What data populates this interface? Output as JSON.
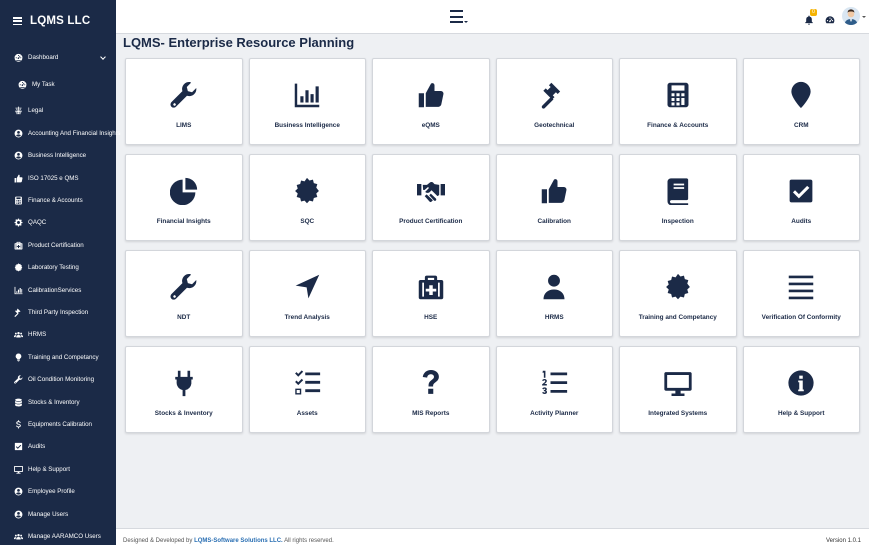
{
  "app": {
    "title": "LQMS LLC"
  },
  "sidebar": {
    "items": [
      {
        "label": "Dashboard",
        "icon": "dashboard-icon"
      },
      {
        "label": "My Task",
        "icon": "dashboard-icon"
      },
      {
        "label": "Legal",
        "icon": "balance-scale-icon"
      },
      {
        "label": "Accounting And Financial Insights",
        "icon": "user-circle-icon"
      },
      {
        "label": "Business Intelligence",
        "icon": "user-circle-icon"
      },
      {
        "label": "ISO 17025 e QMS",
        "icon": "thumbs-up-icon"
      },
      {
        "label": "Finance & Accounts",
        "icon": "calculator-icon"
      },
      {
        "label": "QAQC",
        "icon": "gear-icon"
      },
      {
        "label": "Product Certification",
        "icon": "medkit-icon"
      },
      {
        "label": "Laboratory Testing",
        "icon": "certificate-icon"
      },
      {
        "label": "CalibrationServices",
        "icon": "chart-icon"
      },
      {
        "label": "Third Party Inspection",
        "icon": "gavel-icon"
      },
      {
        "label": "HRMS",
        "icon": "users-icon"
      },
      {
        "label": "Training and Competancy",
        "icon": "lightbulb-icon"
      },
      {
        "label": "Oil Condition Monitoring",
        "icon": "wrench-icon"
      },
      {
        "label": "Stocks & Inventory",
        "icon": "database-icon"
      },
      {
        "label": "Equipments Calibration",
        "icon": "dollar-icon"
      },
      {
        "label": "Audits",
        "icon": "check-square-icon"
      },
      {
        "label": "Help & Support",
        "icon": "desktop-icon"
      },
      {
        "label": "Employee Profile",
        "icon": "user-circle-icon"
      },
      {
        "label": "Manage Users",
        "icon": "user-circle-icon"
      },
      {
        "label": "Manage AARAMCO Users",
        "icon": "users-icon"
      }
    ]
  },
  "topbar": {
    "notification_count": "0"
  },
  "main": {
    "title": "LQMS- Enterprise Resource Planning",
    "tiles": [
      {
        "label": "LIMS",
        "icon": "wrench-icon"
      },
      {
        "label": "Business Intelligence",
        "icon": "bar-chart-icon"
      },
      {
        "label": "eQMS",
        "icon": "thumbs-up-icon"
      },
      {
        "label": "Geotechnical",
        "icon": "gavel-icon"
      },
      {
        "label": "Finance & Accounts",
        "icon": "calculator-icon"
      },
      {
        "label": "CRM",
        "icon": "map-marker-icon"
      },
      {
        "label": "Financial Insights",
        "icon": "pie-chart-icon"
      },
      {
        "label": "SQC",
        "icon": "certificate-icon"
      },
      {
        "label": "Product Certification",
        "icon": "handshake-icon"
      },
      {
        "label": "Calibration",
        "icon": "thumbs-up-icon"
      },
      {
        "label": "Inspection",
        "icon": "book-icon"
      },
      {
        "label": "Audits",
        "icon": "check-square-icon"
      },
      {
        "label": "NDT",
        "icon": "wrench-icon"
      },
      {
        "label": "Trend Analysis",
        "icon": "location-arrow-icon"
      },
      {
        "label": "HSE",
        "icon": "medkit-icon"
      },
      {
        "label": "HRMS",
        "icon": "user-icon"
      },
      {
        "label": "Training and Competancy",
        "icon": "certificate-icon"
      },
      {
        "label": "Verification Of Conformity",
        "icon": "list-lines-icon"
      },
      {
        "label": "Stocks & Inventory",
        "icon": "plug-icon"
      },
      {
        "label": "Assets",
        "icon": "tasks-icon"
      },
      {
        "label": "MIS Reports",
        "icon": "question-icon"
      },
      {
        "label": "Activity Planner",
        "icon": "ordered-list-icon"
      },
      {
        "label": "Integrated Systems",
        "icon": "desktop-icon"
      },
      {
        "label": "Help & Support",
        "icon": "info-circle-icon"
      }
    ]
  },
  "footer": {
    "prefix": "Designed & Developed by",
    "company": "LQMS-Software Solutions LLC.",
    "suffix": "All rights reserved.",
    "version": "Version 1.0.1"
  }
}
